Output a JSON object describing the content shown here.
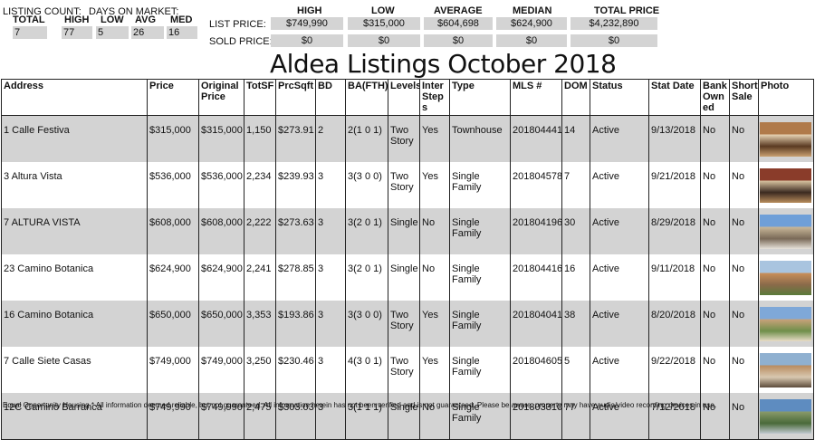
{
  "stats": {
    "listing_count_label": "LISTING COUNT:",
    "dom_label": "DAYS ON MARKET:",
    "headers": [
      "TOTAL",
      "HIGH",
      "LOW",
      "AVG",
      "MED"
    ],
    "values": [
      "7",
      "77",
      "5",
      "26",
      "16"
    ]
  },
  "prices": {
    "headers": [
      "HIGH",
      "LOW",
      "AVERAGE",
      "MEDIAN",
      "TOTAL PRICE"
    ],
    "list_label": "LIST PRICE:",
    "list_values": [
      "$749,990",
      "$315,000",
      "$604,698",
      "$624,900",
      "$4,232,890"
    ],
    "sold_label": "SOLD PRICE:",
    "sold_values": [
      "$0",
      "$0",
      "$0",
      "$0",
      "$0"
    ]
  },
  "title": "Aldea Listings October 2018",
  "table": {
    "columns": [
      "Address",
      "Price",
      "Original Price",
      "TotSF",
      "PrcSqft",
      "BD",
      "BA(FTH)",
      "Levels",
      "InterSteps",
      "Type",
      "MLS #",
      "DOM",
      "Status",
      "Stat Date",
      "Bank Owned",
      "Short Sale",
      "Photo"
    ],
    "rows": [
      {
        "address": "1 Calle Festiva",
        "price": "$315,000",
        "orig": "$315,000",
        "sf": "1,150",
        "psf": "$273.91",
        "bd": "2",
        "ba": "2(1 0 1)",
        "levels": "Two Story",
        "steps": "Yes",
        "type": "Townhouse",
        "mls": "201804441",
        "dom": "14",
        "status": "Active",
        "date": "9/13/2018",
        "bank": "No",
        "short": "No",
        "photo": "interior-photo"
      },
      {
        "address": "3 Altura Vista",
        "price": "$536,000",
        "orig": "$536,000",
        "sf": "2,234",
        "psf": "$239.93",
        "bd": "3",
        "ba": "3(3 0 0)",
        "levels": "Two Story",
        "steps": "Yes",
        "type": "Single Family",
        "mls": "201804578",
        "dom": "7",
        "status": "Active",
        "date": "9/21/2018",
        "bank": "No",
        "short": "No",
        "photo": "interior-photo"
      },
      {
        "address": "7 ALTURA VISTA",
        "price": "$608,000",
        "orig": "$608,000",
        "sf": "2,222",
        "psf": "$273.63",
        "bd": "3",
        "ba": "3(2 0 1)",
        "levels": "Single",
        "steps": "No",
        "type": "Single Family",
        "mls": "201804196",
        "dom": "30",
        "status": "Active",
        "date": "8/29/2018",
        "bank": "No",
        "short": "No",
        "photo": "exterior-photo"
      },
      {
        "address": "23 Camino Botanica",
        "price": "$624,900",
        "orig": "$624,900",
        "sf": "2,241",
        "psf": "$278.85",
        "bd": "3",
        "ba": "3(2 0 1)",
        "levels": "Single",
        "steps": "No",
        "type": "Single Family",
        "mls": "201804416",
        "dom": "16",
        "status": "Active",
        "date": "9/11/2018",
        "bank": "No",
        "short": "No",
        "photo": "exterior-photo"
      },
      {
        "address": "16 Camino Botanica",
        "price": "$650,000",
        "orig": "$650,000",
        "sf": "3,353",
        "psf": "$193.86",
        "bd": "3",
        "ba": "3(3 0 0)",
        "levels": "Two Story",
        "steps": "Yes",
        "type": "Single Family",
        "mls": "201804041",
        "dom": "38",
        "status": "Active",
        "date": "8/20/2018",
        "bank": "No",
        "short": "No",
        "photo": "exterior-photo"
      },
      {
        "address": "7 Calle Siete Casas",
        "price": "$749,000",
        "orig": "$749,000",
        "sf": "3,250",
        "psf": "$230.46",
        "bd": "3",
        "ba": "4(3 0 1)",
        "levels": "Two Story",
        "steps": "Yes",
        "type": "Single Family",
        "mls": "201804605",
        "dom": "5",
        "status": "Active",
        "date": "9/22/2018",
        "bank": "No",
        "short": "No",
        "photo": "exterior-photo"
      },
      {
        "address": "12C Camino Barranca",
        "price": "$749,990",
        "orig": "$749,990",
        "sf": "2,475",
        "psf": "$303.03",
        "bd": "3",
        "ba": "3(1 1 1)",
        "levels": "Single",
        "steps": "No",
        "type": "Single Family",
        "mls": "201803310",
        "dom": "77",
        "status": "Active",
        "date": "7/12/2018",
        "bank": "No",
        "short": "No",
        "photo": "landscape-photo"
      }
    ]
  },
  "footer": "Equal Opportunity Housing * All information deemed reliable, but not guaranteed. All information herein has not been verified and is not guaranteed. Please be aware, property may have audio/video recording devices in use."
}
